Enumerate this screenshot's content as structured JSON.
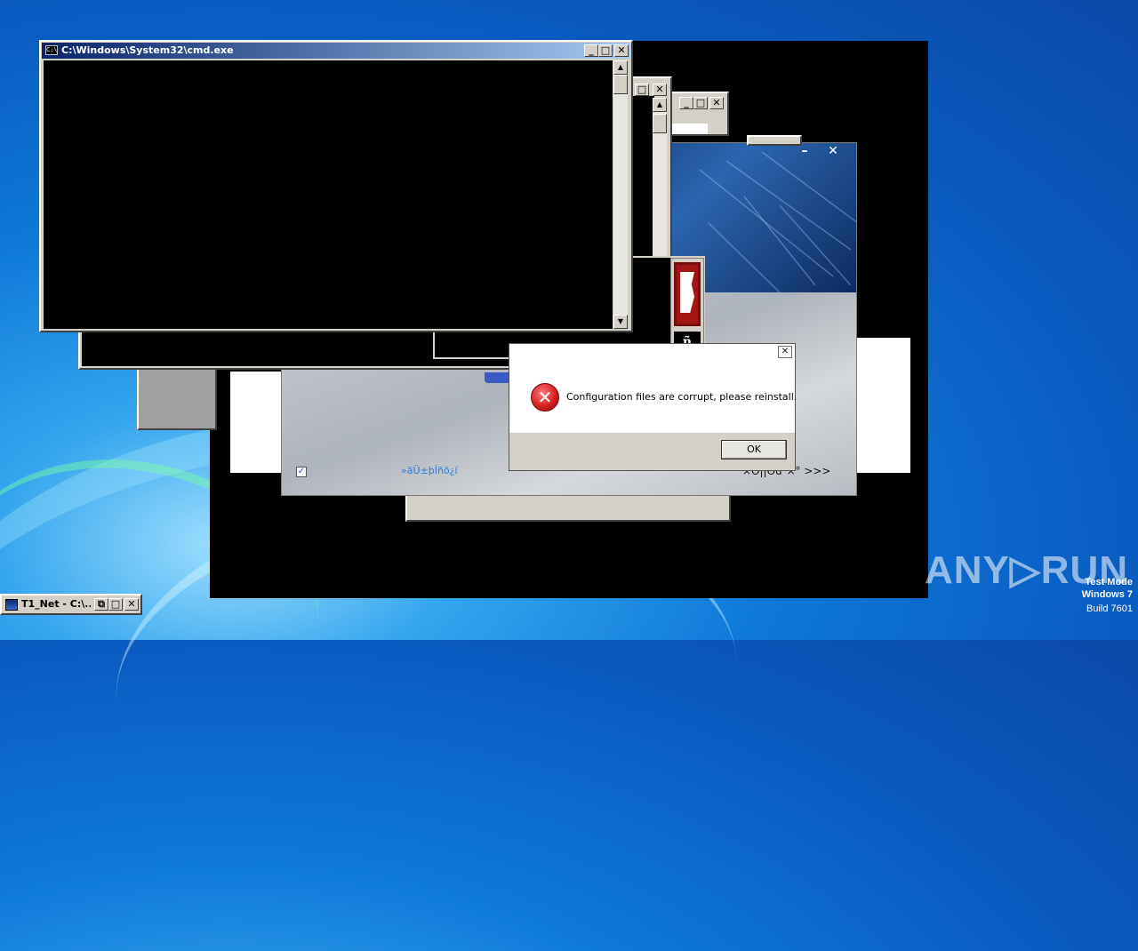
{
  "cmd_window": {
    "title": "C:\\Windows\\System32\\cmd.exe",
    "min_glyph": "_",
    "max_glyph": "□",
    "close_glyph": "✕"
  },
  "installer": {
    "checkbox_label": "»äÜ±þÍñõ¿í",
    "nav_text": "×Ó||Óú²×° >>>"
  },
  "dialog": {
    "message": "Configuration files are corrupt, please reinstall.",
    "ok_label": "OK",
    "close_glyph": "✕"
  },
  "taskbar_item": {
    "label": "T1_Net - C:\\..."
  },
  "watermark": {
    "brand": "ANY▷RUN",
    "test_mode": "Test Mode",
    "windows": "Windows 7",
    "build": "Build 7601"
  },
  "colors": {
    "title_active": "#0a246a",
    "error_red": "#d42020"
  }
}
